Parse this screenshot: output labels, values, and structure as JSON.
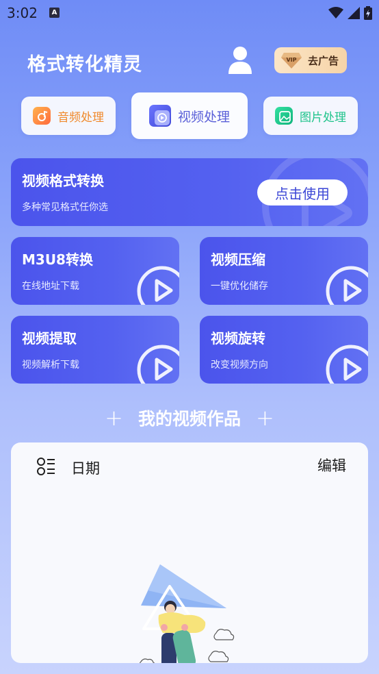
{
  "status_bar": {
    "time": "3:02",
    "notification_icon": "A"
  },
  "header": {
    "title": "格式转化精灵",
    "vip_label": "去广告",
    "vip_badge": "VIP"
  },
  "categories": [
    {
      "label": "音频处理",
      "icon": "audio-icon",
      "color": "#f08a2c",
      "active": false
    },
    {
      "label": "视频处理",
      "icon": "video-icon",
      "color": "#5a5fd8",
      "active": true
    },
    {
      "label": "图片处理",
      "icon": "image-icon",
      "color": "#1ec38a",
      "active": false
    }
  ],
  "featured": {
    "title": "视频格式转换",
    "subtitle": "多种常见格式任你选",
    "button_label": "点击使用"
  },
  "tools": [
    {
      "title": "M3U8转换",
      "subtitle": "在线地址下载"
    },
    {
      "title": "视频压缩",
      "subtitle": "一键优化储存"
    },
    {
      "title": "视频提取",
      "subtitle": "视频解析下载"
    },
    {
      "title": "视频旋转",
      "subtitle": "改变视频方向"
    }
  ],
  "works": {
    "section_title": "我的视频作品",
    "sort_label": "日期",
    "edit_label": "编辑"
  },
  "colors": {
    "accent": "#4b54ec",
    "background_top": "#6f8cf6",
    "panel": "#f8f9fd"
  }
}
